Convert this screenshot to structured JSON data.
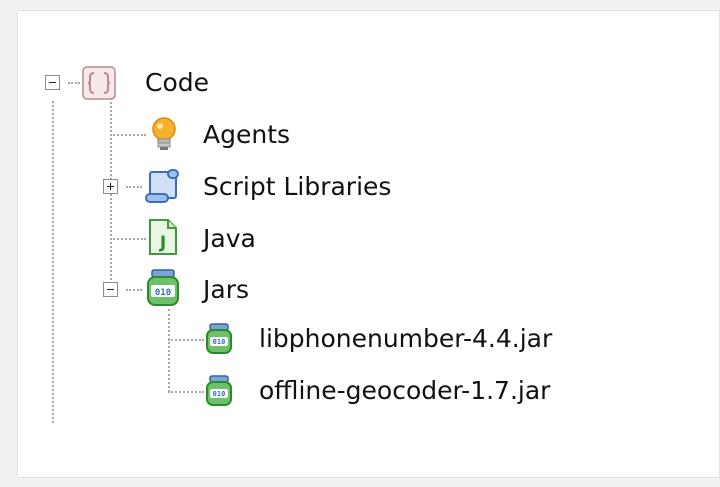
{
  "tree": {
    "root": {
      "label": "Code",
      "icon": "code-brackets-icon",
      "expanded": true
    },
    "items": [
      {
        "label": "Agents",
        "icon": "lightbulb-icon"
      },
      {
        "label": "Script Libraries",
        "icon": "script-scroll-icon",
        "expanded": false
      },
      {
        "label": "Java",
        "icon": "java-file-icon"
      },
      {
        "label": "Jars",
        "icon": "jar-icon",
        "expanded": true,
        "children": [
          {
            "label": "libphonenumber-4.4.jar",
            "icon": "jar-icon"
          },
          {
            "label": "offline-geocoder-1.7.jar",
            "icon": "jar-icon"
          }
        ]
      }
    ]
  },
  "colors": {
    "accent": "#2f6fbf",
    "jar_green": "#3fa54a",
    "bulb": "#f6b02c"
  }
}
